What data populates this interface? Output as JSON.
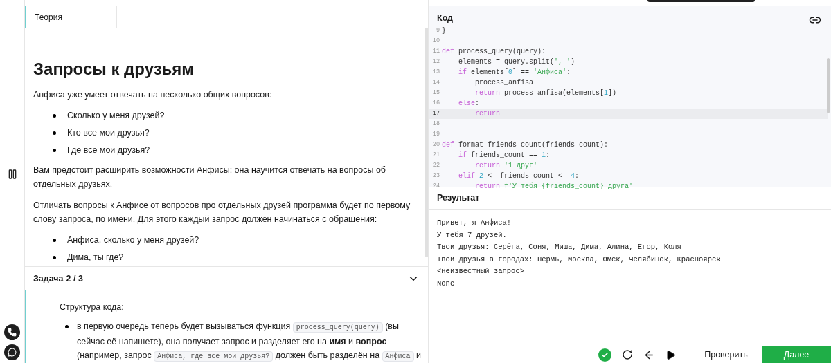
{
  "theory": {
    "tab": {
      "label": "Теория",
      "selected": true
    },
    "title": "Запросы к друзьям",
    "blocks": [
      {
        "kind": "p",
        "text": "Анфиса уже умеет отвечать на несколько общих вопросов:"
      },
      {
        "kind": "list",
        "items": [
          "Сколько у меня друзей?",
          "Кто все мои друзья?",
          "Где все мои друзья?"
        ]
      },
      {
        "kind": "p",
        "text": "Вам предстоит расширить возможности Анфисы: она научится отвечать на вопросы об отдельных друзьях."
      },
      {
        "kind": "p",
        "text": "Отличать вопросы к Анфисе от вопросов про отдельных друзей программа будет по первому слову запроса, по имени. Для этого каждый запрос должен начинаться с обращения:"
      },
      {
        "kind": "list",
        "items": [
          "Анфиса, сколько у меня друзей?",
          "Дима, ты где?"
        ]
      }
    ]
  },
  "task": {
    "label": "Задача",
    "counter": "2 / 3",
    "expanded": true,
    "intro": "Структура кода:",
    "bullets": [
      [
        {
          "text": "в первую очередь теперь будет вызываться функция ",
          "kind": "text"
        },
        {
          "text": "process_query(query)",
          "kind": "code"
        },
        {
          "text": " (вы сейчас её напишете), она получает запрос и разделяет его на **имя** и **вопрос** (например, запрос ",
          "kind": "text"
        },
        {
          "text": "Анфиса, где все мои друзья?",
          "kind": "code"
        },
        {
          "text": " должен быть разделён на ",
          "kind": "text"
        },
        {
          "text": "Анфиса",
          "kind": "code"
        },
        {
          "text": " и",
          "kind": "text"
        }
      ]
    ]
  },
  "code": {
    "title": "Код",
    "lines": [
      {
        "number": "9",
        "selected": false,
        "tokens": [
          {
            "kind": "plain",
            "text": "}"
          }
        ]
      },
      {
        "number": "10",
        "selected": false
      },
      {
        "number": "11",
        "selected": false,
        "tokens": [
          {
            "kind": "kw",
            "text": "def"
          },
          {
            "kind": "plain",
            "text": " process_query(query):"
          }
        ]
      },
      {
        "number": "12",
        "selected": false,
        "tokens": [
          {
            "kind": "plain",
            "text": "    elements = query.split("
          },
          {
            "kind": "str",
            "text": "', '"
          },
          {
            "kind": "plain",
            "text": ")"
          }
        ]
      },
      {
        "number": "13",
        "selected": false,
        "tokens": [
          {
            "kind": "kw",
            "text": "    if"
          },
          {
            "kind": "plain",
            "text": " elements["
          },
          {
            "kind": "num",
            "text": "0"
          },
          {
            "kind": "plain",
            "text": "] == "
          },
          {
            "kind": "str",
            "text": "'Анфиса'"
          },
          {
            "kind": "plain",
            "text": ":"
          }
        ]
      },
      {
        "number": "14",
        "selected": false,
        "tokens": [
          {
            "kind": "plain",
            "text": "        process_anfisa"
          }
        ]
      },
      {
        "number": "15",
        "selected": false,
        "tokens": [
          {
            "kind": "kw",
            "text": "        return"
          },
          {
            "kind": "plain",
            "text": " process_anfisa(elements["
          },
          {
            "kind": "num",
            "text": "1"
          },
          {
            "kind": "plain",
            "text": "])"
          }
        ]
      },
      {
        "number": "16",
        "selected": false,
        "tokens": [
          {
            "kind": "kw",
            "text": "    else"
          },
          {
            "kind": "plain",
            "text": ":"
          }
        ]
      },
      {
        "number": "17",
        "selected": true,
        "tokens": [
          {
            "kind": "kw",
            "text": "        return"
          }
        ]
      },
      {
        "number": "18",
        "selected": false
      },
      {
        "number": "19",
        "selected": false
      },
      {
        "number": "20",
        "selected": false,
        "tokens": [
          {
            "kind": "kw",
            "text": "def"
          },
          {
            "kind": "plain",
            "text": " format_friends_count(friends_count):"
          }
        ]
      },
      {
        "number": "21",
        "selected": false,
        "tokens": [
          {
            "kind": "kw",
            "text": "    if"
          },
          {
            "kind": "plain",
            "text": " friends_count == "
          },
          {
            "kind": "num",
            "text": "1"
          },
          {
            "kind": "plain",
            "text": ":"
          }
        ]
      },
      {
        "number": "22",
        "selected": false,
        "tokens": [
          {
            "kind": "kw",
            "text": "        return"
          },
          {
            "kind": "str",
            "text": " '1 друг'"
          }
        ]
      },
      {
        "number": "23",
        "selected": false,
        "tokens": [
          {
            "kind": "kw",
            "text": "    elif "
          },
          {
            "kind": "num",
            "text": "2"
          },
          {
            "kind": "plain",
            "text": " <= friends_count <= "
          },
          {
            "kind": "num",
            "text": "4"
          },
          {
            "kind": "plain",
            "text": ":"
          }
        ]
      },
      {
        "number": "24",
        "selected": false,
        "tokens": [
          {
            "kind": "kw",
            "text": "        return"
          },
          {
            "kind": "str",
            "text": " f'У тебя {friends_count} друга'"
          }
        ]
      }
    ]
  },
  "result": {
    "title": "Результат",
    "lines": [
      "Привет, я Анфиса!",
      "У тебя 7 друзей.",
      "Твои друзья: Серёга, Соня, Миша, Дима, Алина, Егор, Коля",
      "Твои друзья в городах: Пермь, Москва, Омск, Челябинск, Красноярск",
      "<неизвестный запрос>",
      "None"
    ]
  },
  "toolbar": {
    "passed": true,
    "check_button": "Проверить",
    "next_button": "Далее"
  }
}
